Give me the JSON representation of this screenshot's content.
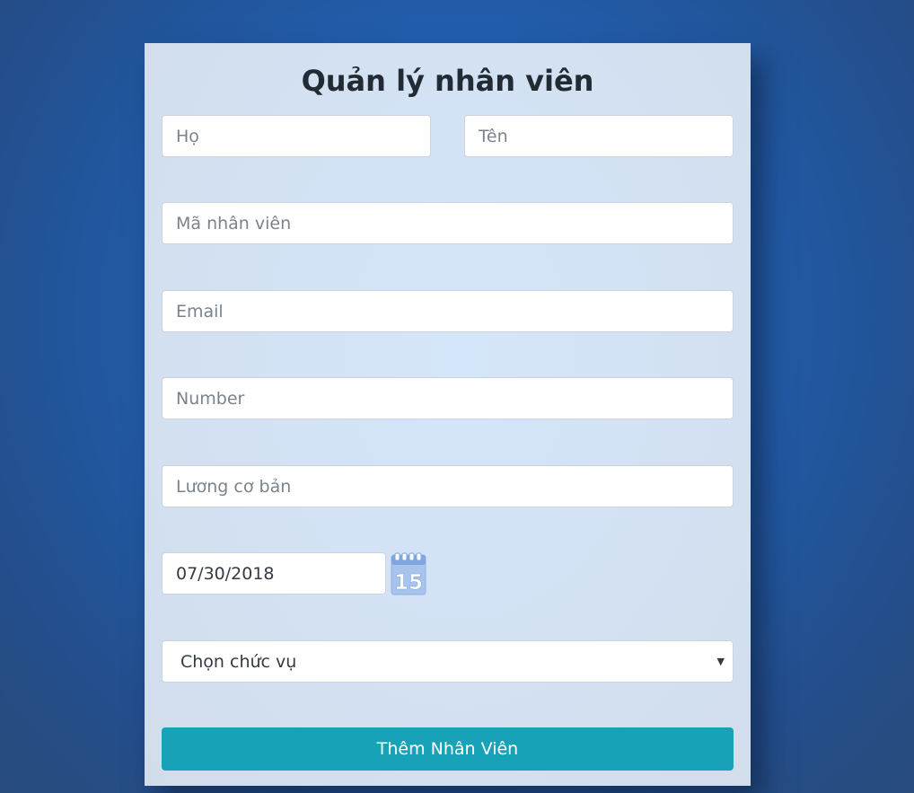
{
  "form": {
    "title": "Quản lý nhân viên",
    "last_name_placeholder": "Họ",
    "first_name_placeholder": "Tên",
    "employee_id_placeholder": "Mã nhân viên",
    "email_placeholder": "Email",
    "number_placeholder": "Number",
    "salary_placeholder": "Lương cơ bản",
    "date_value": "07/30/2018",
    "calendar_icon": "calendar-icon",
    "calendar_day": "15",
    "position_select": {
      "selected": "Chọn chức vụ",
      "arrow": "▼"
    },
    "submit_label": "Thêm Nhân Viên"
  },
  "colors": {
    "background": "#2160b3",
    "card": "#d3e2f4",
    "button": "#17a2b8",
    "title_text": "#222a33",
    "placeholder_text": "#7a838c"
  }
}
